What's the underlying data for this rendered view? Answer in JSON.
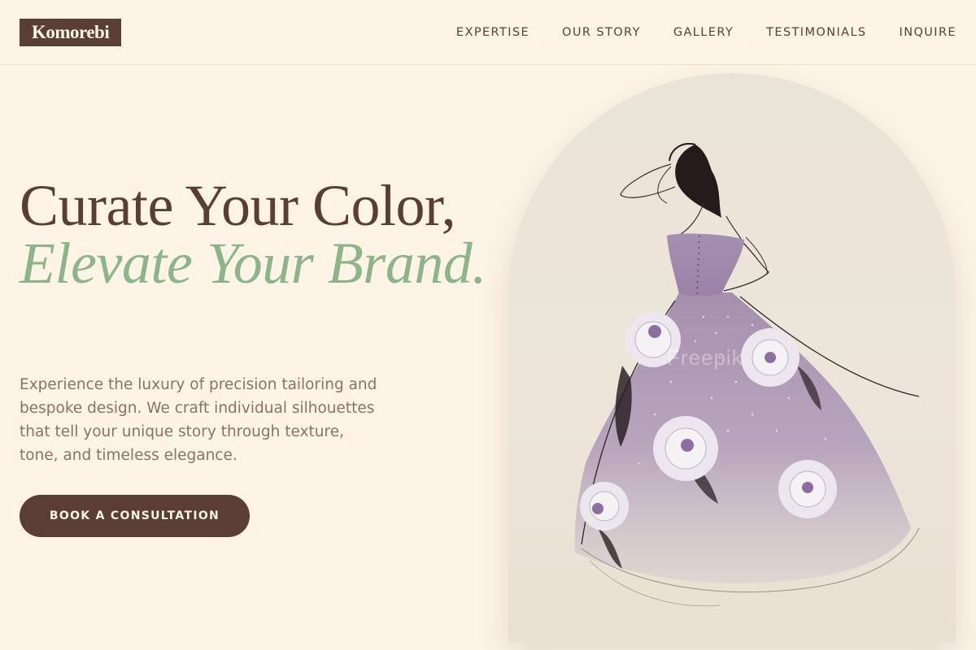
{
  "brand": {
    "logo_text": "Komorebi"
  },
  "nav": {
    "items": [
      {
        "label": "EXPERTISE"
      },
      {
        "label": "OUR STORY"
      },
      {
        "label": "GALLERY"
      },
      {
        "label": "TESTIMONIALS"
      },
      {
        "label": "INQUIRE"
      }
    ]
  },
  "hero": {
    "title_line1": "Curate Your Color,",
    "title_line2": "Elevate Your Brand.",
    "description": "Experience the luxury of precision tailoring and bespoke design. We craft individual silhouettes that tell your unique story through texture, tone, and timeless elegance.",
    "cta_label": "BOOK A CONSULTATION",
    "image": {
      "subject": "watercolor sketch of lilac ball gown with white roses",
      "watermark": "Freepik"
    }
  },
  "colors": {
    "background": "#fdf4e6",
    "primary": "#5a3e36",
    "accent": "#8db58a",
    "body_text": "#8b7168",
    "gown": "#a58fb0"
  }
}
